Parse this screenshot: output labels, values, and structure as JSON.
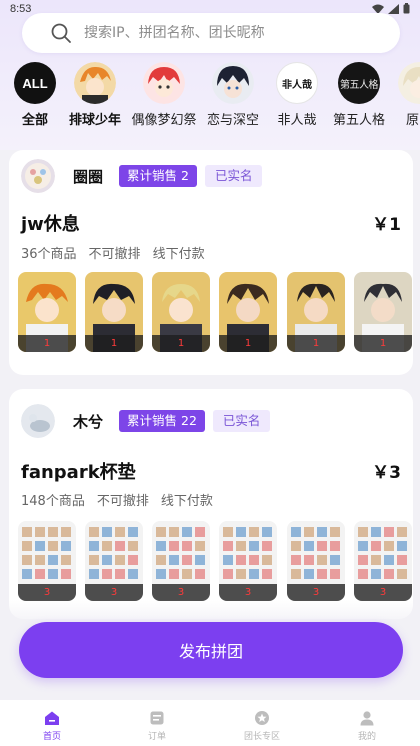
{
  "status": {
    "time": "8:53"
  },
  "search": {
    "placeholder": "搜索IP、拼团名称、团长昵称"
  },
  "categories": [
    {
      "label": "全部",
      "icon": "all-badge"
    },
    {
      "label": "排球少年",
      "icon": "haikyu-avatar"
    },
    {
      "label": "偶像梦幻祭",
      "icon": "ensemble-avatar"
    },
    {
      "label": "恋与深空",
      "icon": "love-deepspace-avatar"
    },
    {
      "label": "非人哉",
      "icon": "feirenzai-avatar"
    },
    {
      "label": "第五人格",
      "icon": "identity-v-avatar"
    },
    {
      "label": "原",
      "icon": "genshin-avatar"
    }
  ],
  "all_badge_text": "ALL",
  "feirenzai_logo_text": "非人哉",
  "identityv_logo_text": "第五人格",
  "groups": [
    {
      "host": "圈圈",
      "sales_badge": "累计销售 2",
      "verified_badge": "已实名",
      "title": "jw休息",
      "price": "￥1",
      "meta": [
        "36个商品",
        "不可撤排",
        "线下付款"
      ],
      "thumb_qty": [
        "1",
        "1",
        "1",
        "1",
        "1",
        "1"
      ]
    },
    {
      "host": "木兮",
      "sales_badge": "累计销售 22",
      "verified_badge": "已实名",
      "title": "fanpark杯垫",
      "price": "￥3",
      "meta": [
        "148个商品",
        "不可撤排",
        "线下付款"
      ],
      "thumb_qty": [
        "3",
        "3",
        "3",
        "3",
        "3",
        "3"
      ]
    }
  ],
  "publish_label": "发布拼团",
  "tabs": [
    {
      "label": "首页",
      "icon": "home-icon"
    },
    {
      "label": "订单",
      "icon": "order-icon"
    },
    {
      "label": "团长专区",
      "icon": "leader-star-icon"
    },
    {
      "label": "我的",
      "icon": "profile-icon"
    }
  ],
  "colors": {
    "accent": "#7c3ff0",
    "badge_bg": "#7d45e8",
    "verified_bg": "#efe9fd"
  }
}
